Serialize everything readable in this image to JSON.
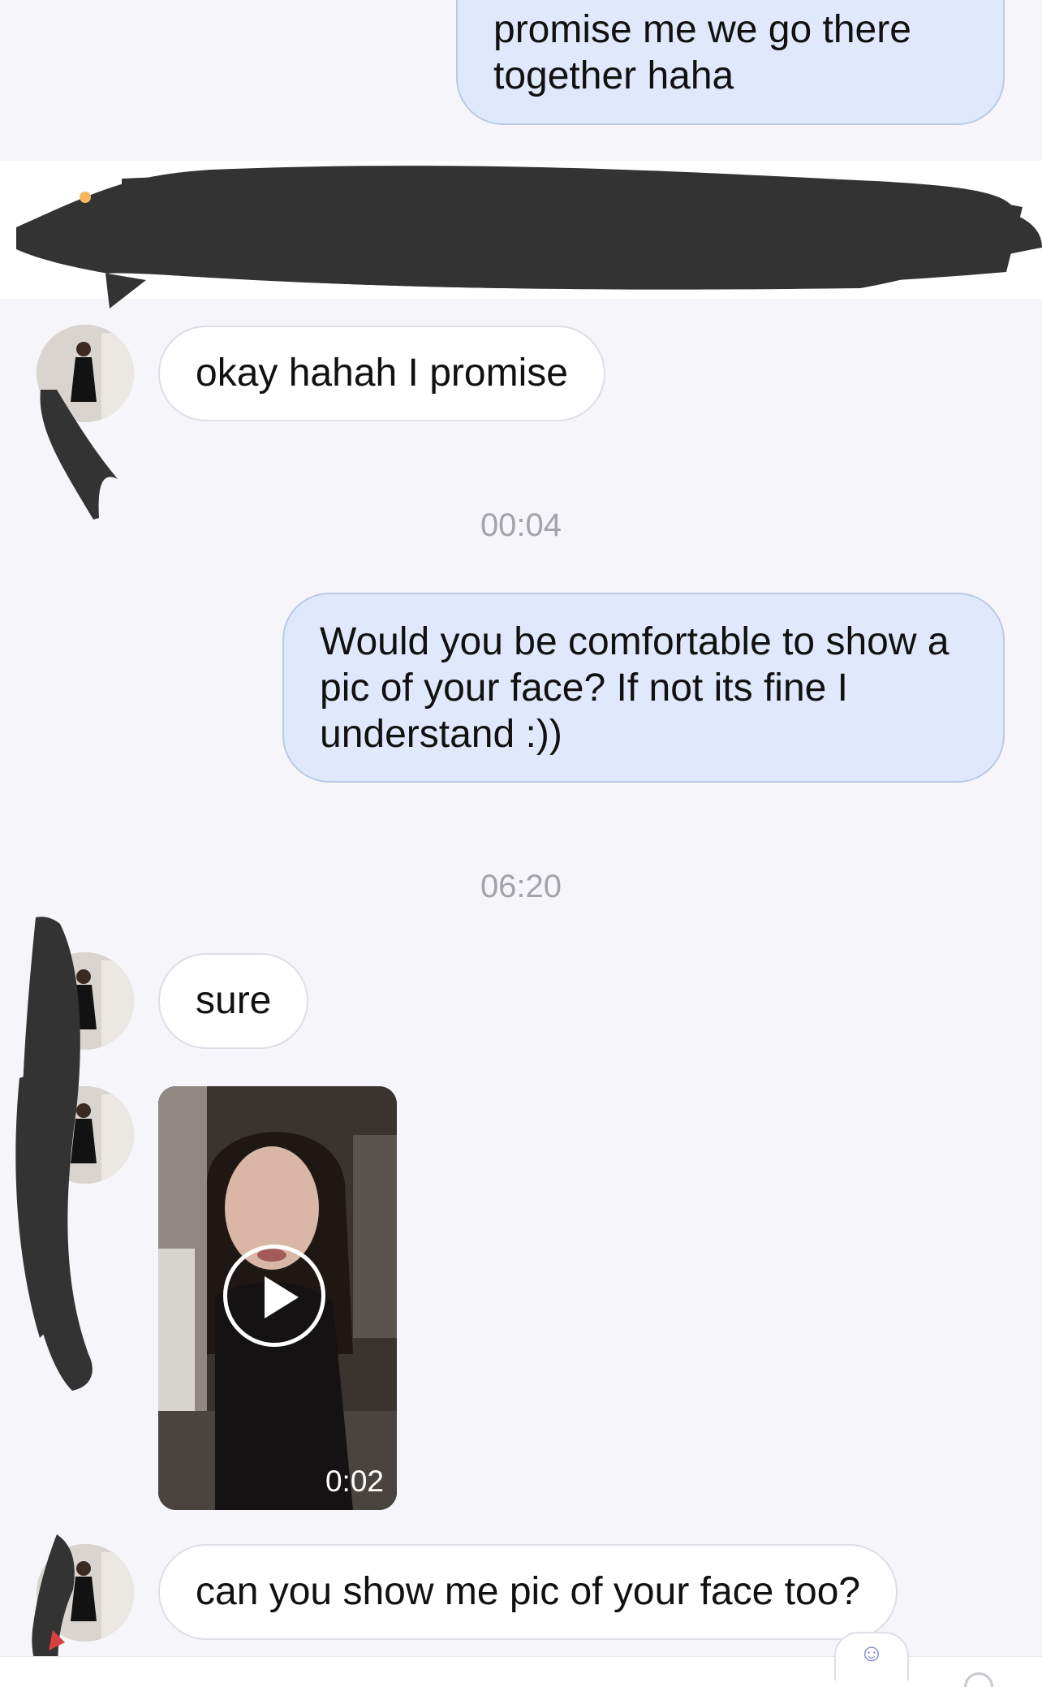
{
  "conversation": {
    "messages": [
      {
        "direction": "outgoing",
        "text": "promise me we go there together haha"
      },
      {
        "direction": "incoming",
        "text": "okay hahah I promise"
      },
      {
        "direction": "outgoing",
        "text": "Would you be comfortable to show a pic of your face? If not its fine I understand :))"
      },
      {
        "direction": "incoming",
        "text": "sure"
      },
      {
        "direction": "incoming",
        "type": "video",
        "duration": "0:02"
      },
      {
        "direction": "incoming",
        "text": "can you show me pic of your face too?"
      }
    ],
    "timestamps": [
      "00:04",
      "06:20"
    ]
  },
  "icons": {
    "avatar": "avatar",
    "play": "play-icon",
    "react": "add-reaction-icon"
  },
  "colors": {
    "background": "#f5f5fa",
    "outgoing_bubble": "#dfe9fb",
    "incoming_bubble": "#ffffff",
    "timestamp": "#a3a3ab",
    "redaction": "#333333"
  }
}
